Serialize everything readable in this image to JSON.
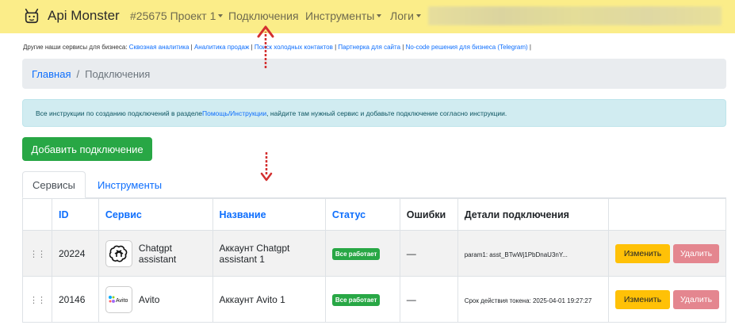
{
  "navbar": {
    "brand": "Api Monster",
    "project": "#25675 Проект 1",
    "connections": "Подключения",
    "tools": "Инструменты",
    "logs": "Логи"
  },
  "services_line": {
    "prefix": "Другие наши сервисы для бизнеса:",
    "links": [
      "Сквозная аналитика",
      "Аналитика продаж",
      "Поиск холодных контактов",
      "Партнерка для сайта",
      "No-code решения для бизнеса (Telegram)"
    ],
    "separator": " | "
  },
  "breadcrumb": {
    "home": "Главная",
    "sep": "/",
    "current": "Подключения"
  },
  "alert": {
    "before": "Все инструкции по созданию подключений в разделе ",
    "link": "Помощь/Инструкции",
    "after": ", найдите там нужный сервис и добавьте подключение согласно инструкции."
  },
  "add_button": "Добавить подключение",
  "tabs": {
    "services": "Сервисы",
    "tools": "Инструменты"
  },
  "table": {
    "headers": {
      "id": "ID",
      "service": "Сервис",
      "name": "Название",
      "status": "Статус",
      "errors": "Ошибки",
      "details": "Детали подключения"
    },
    "rows": [
      {
        "id": "20224",
        "service": "Chatgpt assistant",
        "name": "Аккаунт Chatgpt assistant 1",
        "status": "Все работает",
        "errors": "—",
        "details": "param1: asst_BTwWj1PbDnaU3nY...",
        "edit": "Изменить",
        "delete": "Удалить",
        "logo": "openai-icon"
      },
      {
        "id": "20146",
        "service": "Avito",
        "name": "Аккаунт Avito 1",
        "status": "Все работает",
        "errors": "—",
        "details": "Срок действия токена: 2025-04-01 19:27:27",
        "edit": "Изменить",
        "delete": "Удалить",
        "logo": "avito-icon"
      }
    ]
  },
  "colors": {
    "navbar": "#fbed89",
    "primary": "#0d6efd",
    "success": "#28a745",
    "warning": "#ffc107",
    "danger_light": "#e4868f",
    "annotation": "#d32f2f"
  }
}
